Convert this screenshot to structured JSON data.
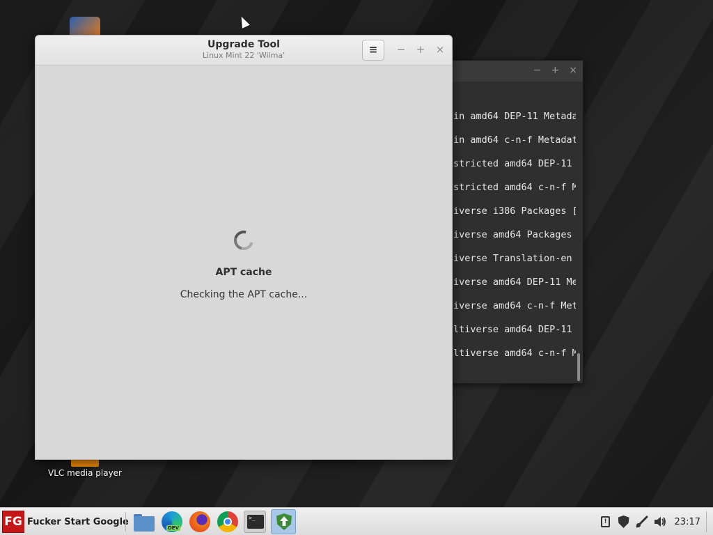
{
  "desktop": {
    "vlc_label": "VLC media player"
  },
  "terminal": {
    "lines": [
      "in amd64 DEP-11 Metada",
      "in amd64 c-n-f Metadat",
      "stricted amd64 DEP-11",
      "stricted amd64 c-n-f M",
      "iverse i386 Packages [",
      "iverse amd64 Packages",
      "iverse Translation-en",
      "iverse amd64 DEP-11 Me",
      "iverse amd64 c-n-f Met",
      "ltiverse amd64 DEP-11",
      "ltiverse amd64 c-n-f M"
    ],
    "controls": {
      "minimize": "−",
      "maximize": "+",
      "close": "×"
    }
  },
  "upgrade_tool": {
    "title": "Upgrade Tool",
    "subtitle": "Linux Mint 22 'Wilma'",
    "menu_glyph": "≡",
    "controls": {
      "minimize": "−",
      "maximize": "+",
      "close": "×"
    },
    "status_title": "APT cache",
    "status_text": "Checking the APT cache..."
  },
  "taskbar": {
    "start_logo": "FG",
    "start_label": "Fucker Start Google",
    "edge_badge": "DEV",
    "terminal_prompt": ">_",
    "tray_clip": "!",
    "clock": "23:17"
  }
}
